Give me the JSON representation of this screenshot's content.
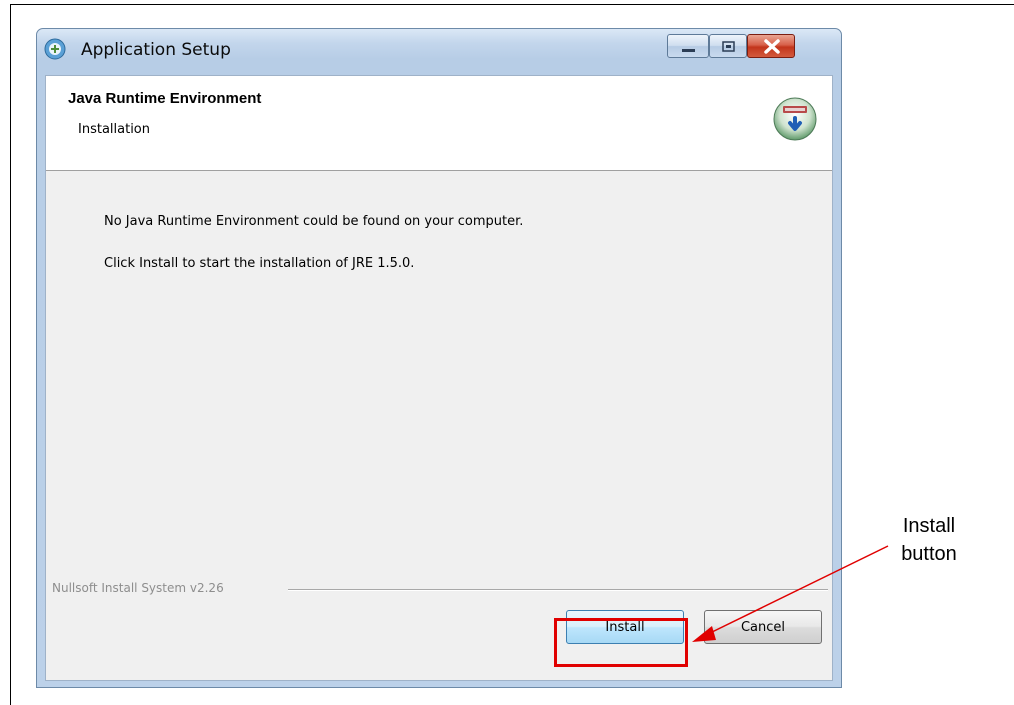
{
  "window": {
    "title": "Application Setup",
    "controls": {
      "minimize_icon": "minimize-icon",
      "maximize_icon": "maximize-icon",
      "close_icon": "close-icon"
    }
  },
  "header": {
    "title": "Java Runtime Environment",
    "subtitle": "Installation",
    "icon": "installer-disk-icon"
  },
  "body": {
    "message_1": "No Java Runtime Environment could be found on your computer.",
    "message_2": "Click Install to start the installation of JRE 1.5.0."
  },
  "footer": {
    "branding": "Nullsoft Install System v2.26",
    "install_label": "Install",
    "cancel_label": "Cancel"
  },
  "annotation": {
    "label_line_1": "Install",
    "label_line_2": "button",
    "color": "#e00000"
  }
}
